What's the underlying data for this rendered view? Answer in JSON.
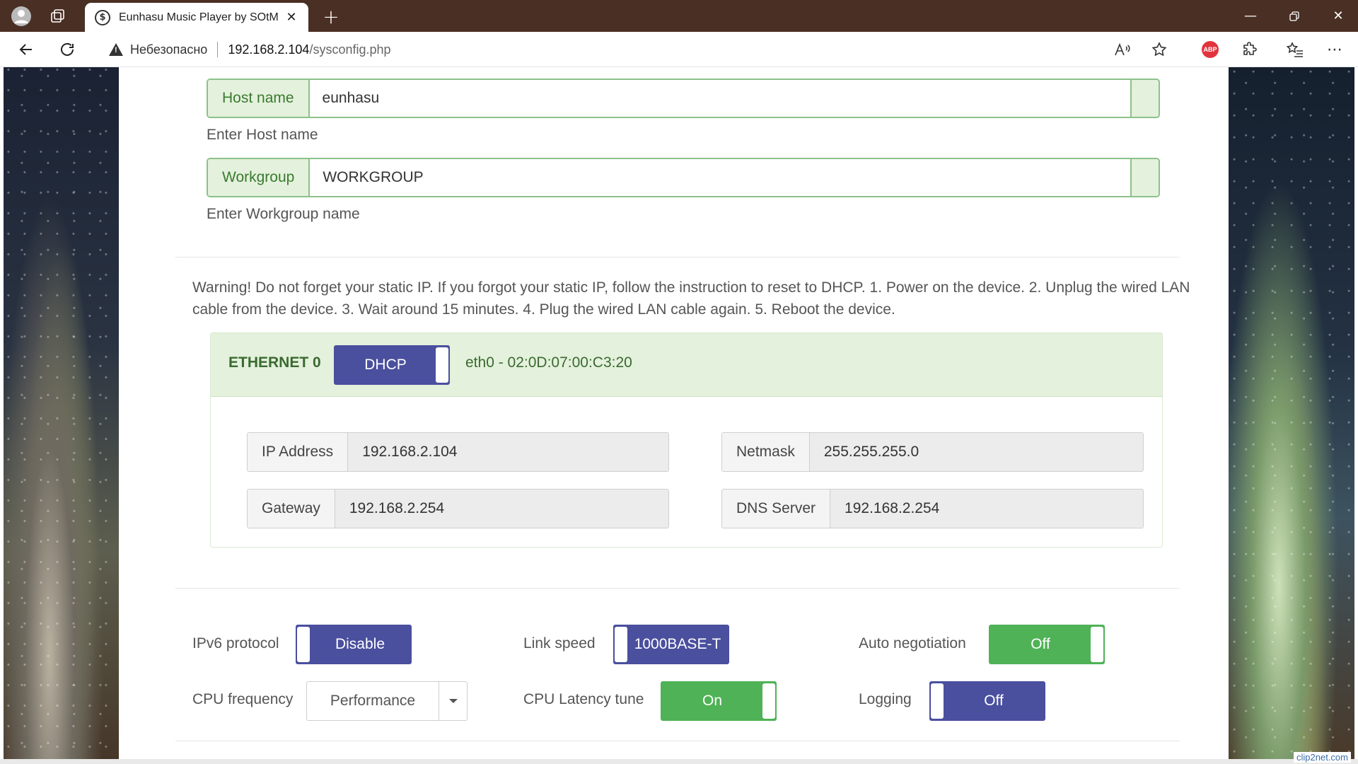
{
  "browser": {
    "tab_title": "Eunhasu Music Player by SOtM",
    "tab_favicon": "$",
    "new_tab": "+",
    "security_label": "Небезопасно",
    "url_host": "192.168.2.104",
    "url_path": "/sysconfig.php",
    "abp_label": "ABP"
  },
  "network_name": {
    "host_label": "Host name",
    "host_value": "eunhasu",
    "host_help": "Enter Host name",
    "workgroup_label": "Workgroup",
    "workgroup_value": "WORKGROUP",
    "workgroup_help": "Enter Workgroup name"
  },
  "warning_text": "Warning! Do not forget your static IP. If you forgot your static IP, follow the instruction to reset to DHCP. 1. Power on the device. 2. Unplug the wired LAN cable from the device. 3. Wait around 15 minutes. 4. Plug the wired LAN cable again. 5. Reboot the device.",
  "ethernet": {
    "title": "ETHERNET 0",
    "mode": "DHCP",
    "interface_info": "eth0 - 02:0D:07:00:C3:20",
    "ip_label": "IP Address",
    "ip_value": "192.168.2.104",
    "netmask_label": "Netmask",
    "netmask_value": "255.255.255.0",
    "gateway_label": "Gateway",
    "gateway_value": "192.168.2.254",
    "dns_label": "DNS Server",
    "dns_value": "192.168.2.254"
  },
  "options": {
    "ipv6_label": "IPv6 protocol",
    "ipv6_value": "Disable",
    "link_speed_label": "Link speed",
    "link_speed_value": "1000BASE-T",
    "auto_neg_label": "Auto negotiation",
    "auto_neg_value": "Off",
    "cpu_freq_label": "CPU frequency",
    "cpu_freq_value": "Performance",
    "cpu_latency_label": "CPU Latency tune",
    "cpu_latency_value": "On",
    "logging_label": "Logging",
    "logging_value": "Off"
  },
  "watermark": "clip2net.com",
  "colors": {
    "titlebar": "#4a2f24",
    "addon_green": "#e4f1dc",
    "toggle_blue": "#4a4f9e",
    "toggle_green": "#4fb256"
  }
}
